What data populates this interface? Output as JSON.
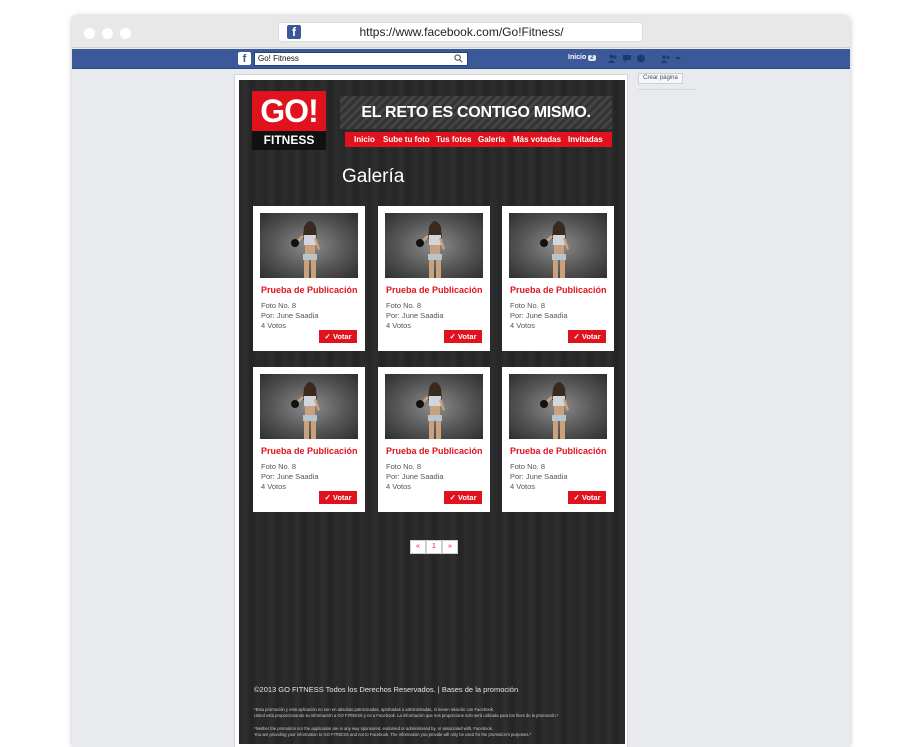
{
  "browser": {
    "url": "https://www.facebook.com/Go!Fitness/"
  },
  "fb_bar": {
    "search_value": "Go! Fitness",
    "home_label": "Inicio",
    "home_count": "2"
  },
  "right_column": {
    "create_page_label": "Crear página"
  },
  "app": {
    "logo_top": "GO!",
    "logo_bottom": "FITNESS",
    "slogan": "EL RETO ES CONTIGO MISMO.",
    "nav": [
      "Inicio",
      "Sube tu foto",
      "Tus fotos",
      "Galería",
      "Más votadas",
      "Invitadas"
    ],
    "section_title": "Galería",
    "cards": [
      {
        "title": "Prueba de Publicación",
        "photo": "Foto No. 8",
        "author": "Por: June Saadia",
        "votes": "4 Votos",
        "vote_label": "Votar"
      },
      {
        "title": "Prueba de Publicación",
        "photo": "Foto No. 8",
        "author": "Por: June Saadia",
        "votes": "4 Votos",
        "vote_label": "Votar"
      },
      {
        "title": "Prueba de Publicación",
        "photo": "Foto No. 8",
        "author": "Por: June Saadia",
        "votes": "4 Votos",
        "vote_label": "Votar"
      },
      {
        "title": "Prueba de Publicación",
        "photo": "Foto No. 8",
        "author": "Por: June Saadia",
        "votes": "4 Votos",
        "vote_label": "Votar"
      },
      {
        "title": "Prueba de Publicación",
        "photo": "Foto No. 8",
        "author": "Por: June Saadia",
        "votes": "4 Votos",
        "vote_label": "Votar"
      },
      {
        "title": "Prueba de Publicación",
        "photo": "Foto No. 8",
        "author": "Por: June Saadia",
        "votes": "4 Votos",
        "vote_label": "Votar"
      }
    ],
    "pagination": {
      "prev": "«",
      "current": "1",
      "next": "»"
    },
    "footer": {
      "copyright": "©2013 GO FITNESS Todos los Derechos Reservados. | Bases de la promoción",
      "disclaimer_es_1": "*Esta promoción y esta aplicación no son en absoluto patrocinadas, aprobadas o administradas, ni tienen relación con Facebook.",
      "disclaimer_es_2": "Usted está proporcionando su información a GO FITNESS y no a Facebook. La información que nos proporcione solo será utilizada para los fines de la promoción.*",
      "disclaimer_en_1": "*Neither the promotion nor the application are in any way sponsored, endorsed or administered by, or associated with, Facebook.",
      "disclaimer_en_2": "You are providing your information to GO FITNESS and not to Facebook. The information you provide will only be used for the promotion's purposes.*"
    }
  },
  "colors": {
    "facebook_blue": "#3b5998",
    "brand_red": "#e0121d",
    "app_background": "#2a2a2a"
  }
}
